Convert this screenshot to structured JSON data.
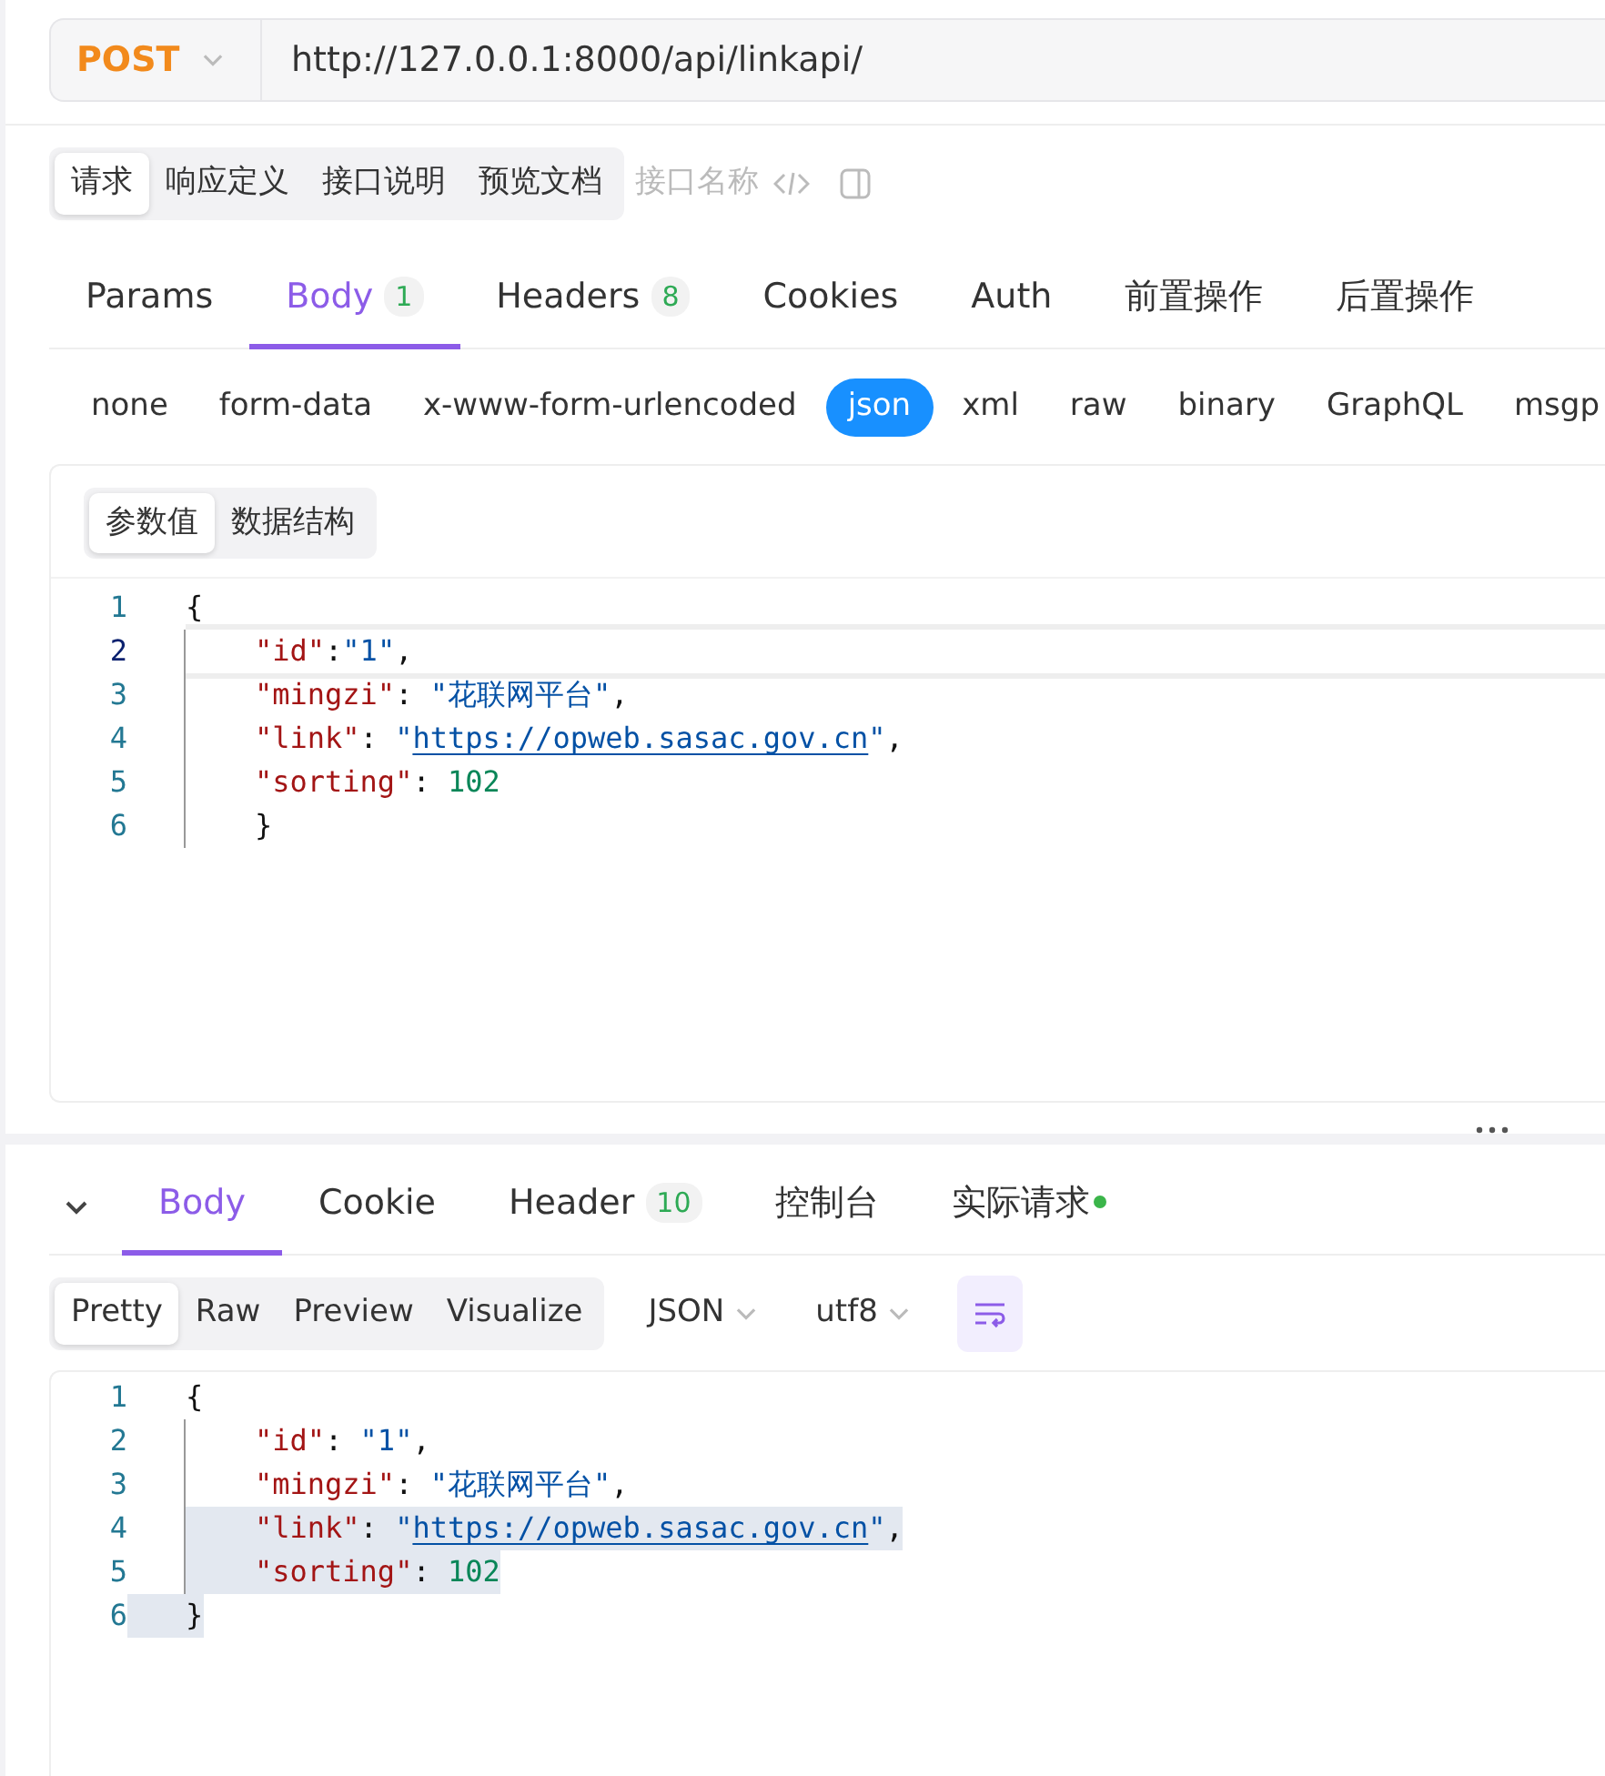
{
  "request": {
    "method": "POST",
    "url": "http://127.0.0.1:8000/api/linkapi/"
  },
  "mode_tabs": [
    {
      "label": "请求",
      "selected": true
    },
    {
      "label": "响应定义",
      "selected": false
    },
    {
      "label": "接口说明",
      "selected": false
    },
    {
      "label": "预览文档",
      "selected": false
    }
  ],
  "name_placeholder": "接口名称",
  "request_tabs": [
    {
      "label": "Params",
      "selected": false
    },
    {
      "label": "Body",
      "count": "1",
      "selected": true
    },
    {
      "label": "Headers",
      "count": "8",
      "selected": false
    },
    {
      "label": "Cookies",
      "selected": false
    },
    {
      "label": "Auth",
      "selected": false
    },
    {
      "label": "前置操作",
      "selected": false
    },
    {
      "label": "后置操作",
      "selected": false
    }
  ],
  "body_types": [
    {
      "label": "none",
      "selected": false
    },
    {
      "label": "form-data",
      "selected": false
    },
    {
      "label": "x-www-form-urlencoded",
      "selected": false
    },
    {
      "label": "json",
      "selected": true
    },
    {
      "label": "xml",
      "selected": false
    },
    {
      "label": "raw",
      "selected": false
    },
    {
      "label": "binary",
      "selected": false
    },
    {
      "label": "GraphQL",
      "selected": false
    },
    {
      "label": "msgp",
      "selected": false
    }
  ],
  "param_tabs": [
    {
      "label": "参数值",
      "selected": true
    },
    {
      "label": "数据结构",
      "selected": false
    }
  ],
  "request_editor": [
    {
      "number": "1",
      "active": false,
      "tokens": [
        {
          "kind": "punct",
          "text": "{"
        }
      ],
      "children": [
        {
          "number": "2",
          "active": true,
          "tokens": [
            {
              "kind": "key",
              "text": "\"id\""
            },
            {
              "kind": "punct",
              "text": ":"
            },
            {
              "kind": "string",
              "text": "\"1\""
            },
            {
              "kind": "punct",
              "text": ","
            }
          ]
        },
        {
          "number": "3",
          "active": false,
          "tokens": [
            {
              "kind": "key",
              "text": "\"mingzi\""
            },
            {
              "kind": "punct",
              "text": ": "
            },
            {
              "kind": "string",
              "text": "\"花联网平台\""
            },
            {
              "kind": "punct",
              "text": ","
            }
          ]
        },
        {
          "number": "4",
          "active": false,
          "tokens": [
            {
              "kind": "key",
              "text": "\"link\""
            },
            {
              "kind": "punct",
              "text": ": "
            },
            {
              "kind": "string",
              "text": "\""
            },
            {
              "kind": "link",
              "text": "https://opweb.sasac.gov.cn"
            },
            {
              "kind": "string",
              "text": "\""
            },
            {
              "kind": "punct",
              "text": ","
            }
          ]
        },
        {
          "number": "5",
          "active": false,
          "tokens": [
            {
              "kind": "key",
              "text": "\"sorting\""
            },
            {
              "kind": "punct",
              "text": ": "
            },
            {
              "kind": "number",
              "text": "102"
            }
          ]
        },
        {
          "number": "6",
          "active": false,
          "tokens": [
            {
              "kind": "punct",
              "text": "}"
            }
          ]
        }
      ]
    }
  ],
  "response_tabs": [
    {
      "label": "Body",
      "selected": true
    },
    {
      "label": "Cookie",
      "selected": false
    },
    {
      "label": "Header",
      "count": "10",
      "selected": false
    },
    {
      "label": "控制台",
      "selected": false
    },
    {
      "label": "实际请求",
      "dot": true,
      "selected": false
    }
  ],
  "view_tabs": [
    {
      "label": "Pretty",
      "selected": true
    },
    {
      "label": "Raw",
      "selected": false
    },
    {
      "label": "Preview",
      "selected": false
    },
    {
      "label": "Visualize",
      "selected": false
    }
  ],
  "format": "JSON",
  "encoding": "utf8",
  "response_editor": [
    {
      "number": "1",
      "selected": false,
      "tokens": [
        {
          "kind": "punct",
          "text": "{"
        }
      ],
      "children": [
        {
          "number": "2",
          "selected": false,
          "tokens": [
            {
              "kind": "key",
              "text": "\"id\""
            },
            {
              "kind": "punct",
              "text": ": "
            },
            {
              "kind": "string",
              "text": "\"1\""
            },
            {
              "kind": "punct",
              "text": ","
            }
          ]
        },
        {
          "number": "3",
          "selected": false,
          "tokens": [
            {
              "kind": "key",
              "text": "\"mingzi\""
            },
            {
              "kind": "punct",
              "text": ": "
            },
            {
              "kind": "string",
              "text": "\"花联网平台\""
            },
            {
              "kind": "punct",
              "text": ","
            }
          ]
        },
        {
          "number": "4",
          "selected": true,
          "tokens": [
            {
              "kind": "key",
              "text": "\"link\""
            },
            {
              "kind": "punct",
              "text": ": "
            },
            {
              "kind": "string",
              "text": "\""
            },
            {
              "kind": "link",
              "text": "https://opweb.sasac.gov.cn"
            },
            {
              "kind": "string",
              "text": "\""
            },
            {
              "kind": "punct",
              "text": ","
            }
          ]
        },
        {
          "number": "5",
          "selected": true,
          "tokens": [
            {
              "kind": "key",
              "text": "\"sorting\""
            },
            {
              "kind": "punct",
              "text": ": "
            },
            {
              "kind": "number",
              "text": "102"
            }
          ]
        }
      ]
    },
    {
      "number": "6",
      "selected": true,
      "tokens": [
        {
          "kind": "punct",
          "text": "}"
        }
      ]
    }
  ]
}
